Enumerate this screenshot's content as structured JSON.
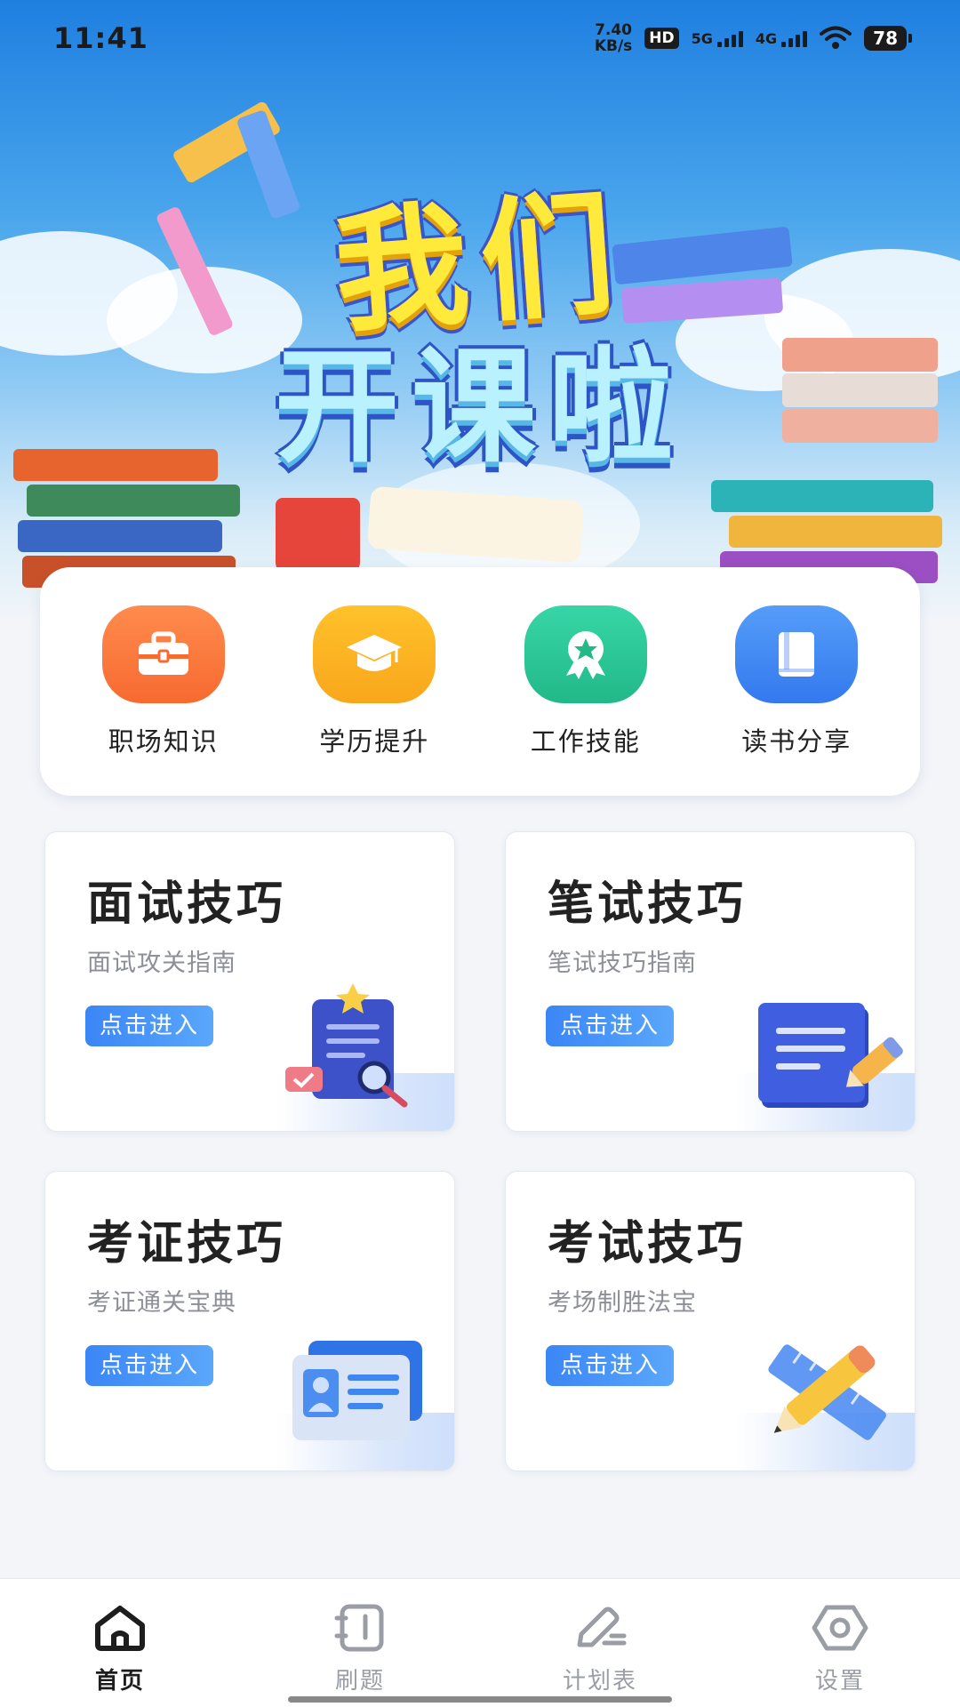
{
  "status_bar": {
    "time": "11:41",
    "net_speed_value": "7.40",
    "net_speed_unit": "KB/s",
    "hd": "HD",
    "signal_1": "5G",
    "signal_2": "4G",
    "battery": "78"
  },
  "banner": {
    "title_line1": "我们",
    "title_line2": "开课啦"
  },
  "categories": [
    {
      "label": "职场知识",
      "icon": "briefcase-icon",
      "color": "#fb7a3f"
    },
    {
      "label": "学历提升",
      "icon": "graduation-cap-icon",
      "color": "#fbb423"
    },
    {
      "label": "工作技能",
      "icon": "award-badge-icon",
      "color": "#2ec99a"
    },
    {
      "label": "读书分享",
      "icon": "book-icon",
      "color": "#3f8cf6"
    }
  ],
  "skills": [
    {
      "title": "面试技巧",
      "subtitle": "面试攻关指南",
      "button": "点击进入",
      "icon": "clipboard-search-icon"
    },
    {
      "title": "笔试技巧",
      "subtitle": "笔试技巧指南",
      "button": "点击进入",
      "icon": "document-pencil-icon"
    },
    {
      "title": "考证技巧",
      "subtitle": "考证通关宝典",
      "button": "点击进入",
      "icon": "id-card-icon"
    },
    {
      "title": "考试技巧",
      "subtitle": "考场制胜法宝",
      "button": "点击进入",
      "icon": "pencil-ruler-icon"
    }
  ],
  "tabbar": {
    "items": [
      {
        "label": "首页",
        "icon": "home-icon",
        "active": true
      },
      {
        "label": "刷题",
        "icon": "notebook-icon",
        "active": false
      },
      {
        "label": "计划表",
        "icon": "edit-pen-icon",
        "active": false
      },
      {
        "label": "设置",
        "icon": "settings-icon",
        "active": false
      }
    ]
  },
  "colors": {
    "accent": "#3b86f6",
    "orange": "#fb7a3f",
    "yellow": "#fbb423",
    "green": "#2ec99a",
    "blue": "#3f8cf6"
  }
}
